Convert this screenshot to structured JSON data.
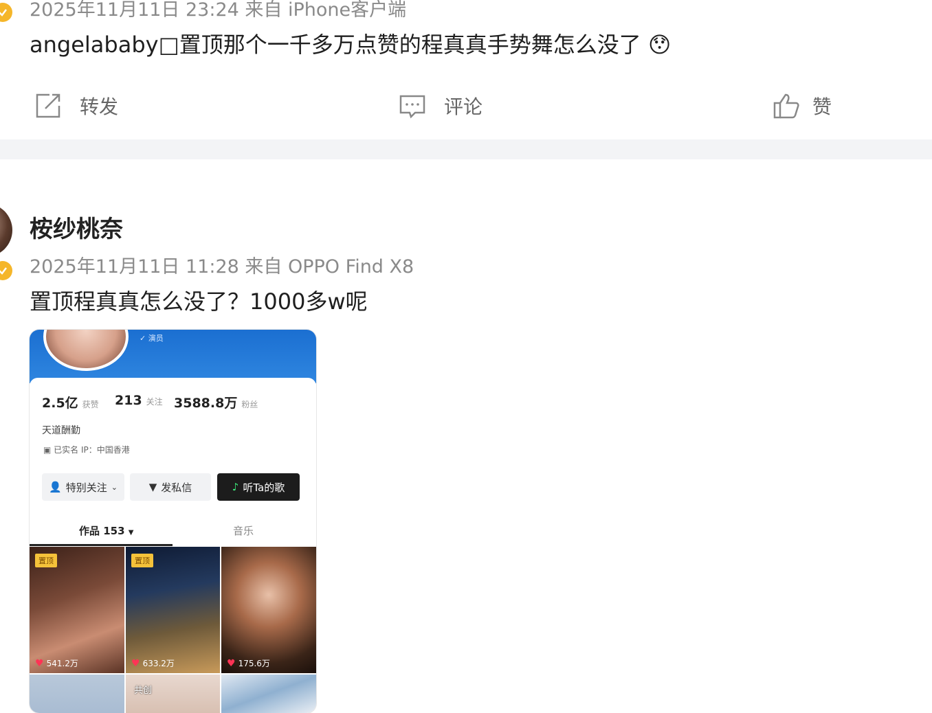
{
  "post1": {
    "meta": "2025年11月11日 23:24  来自 iPhone客户端",
    "text": "angelababy□置顶那个一千多万点赞的程真真手势舞怎么没了",
    "emoji": "😯"
  },
  "actions": {
    "repost": "转发",
    "comment": "评论",
    "like": "赞"
  },
  "post2": {
    "username": "桉纱桃奈",
    "meta": "2025年11月11日 11:28  来自 OPPO Find X8",
    "text": "置顶程真真怎么没了？1000多w呢"
  },
  "card": {
    "badge": "演员",
    "stats": [
      {
        "value": "2.5亿",
        "label": "获赞"
      },
      {
        "value": "213",
        "label": "关注"
      },
      {
        "value": "3588.8万",
        "label": "粉丝"
      }
    ],
    "bio": "天道酬勤",
    "verify_line": "已实名   IP：中国香港",
    "buttons": {
      "follow": "特别关注",
      "message": "发私信",
      "music": "听Ta的歌"
    },
    "tabs": {
      "works": "作品 153",
      "music": "音乐"
    },
    "thumbs": [
      {
        "pin": "置顶",
        "likes": "541.2万"
      },
      {
        "pin": "置顶",
        "likes": "633.2万"
      },
      {
        "pin": "",
        "likes": "175.6万"
      }
    ],
    "row2_label": "共创"
  },
  "colors": {
    "verified": "#f5b62a",
    "divider": "#f3f4f6",
    "card_header": "#1b6fd1"
  }
}
